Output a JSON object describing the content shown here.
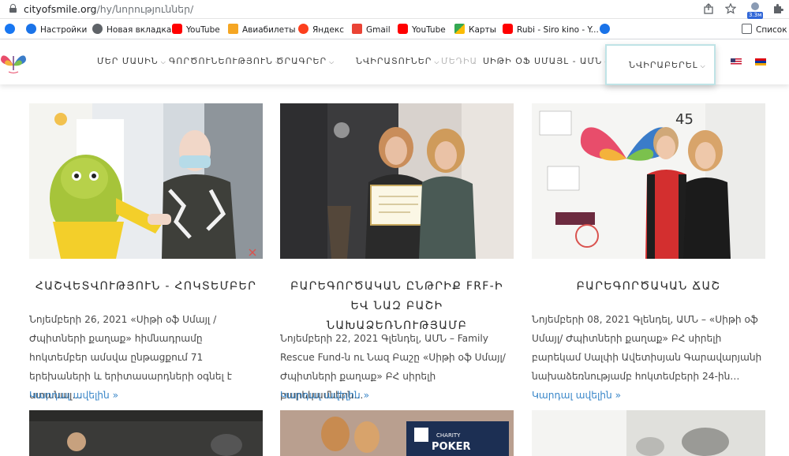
{
  "browser": {
    "url_host": "cityofsmile.org",
    "url_path": "/hy/նորություններ/",
    "profile_badge": "3.3м",
    "bookmarks": [
      {
        "label": "",
        "icon": "facebook-icon"
      },
      {
        "label": "Настройки",
        "icon": "settings-gear-icon"
      },
      {
        "label": "Новая вкладка",
        "icon": "globe-icon"
      },
      {
        "label": "YouTube",
        "icon": "youtube-icon"
      },
      {
        "label": "Авиабилеты",
        "icon": "aviasales-icon"
      },
      {
        "label": "Яндекс",
        "icon": "yandex-icon"
      },
      {
        "label": "Gmail",
        "icon": "gmail-icon"
      },
      {
        "label": "YouTube",
        "icon": "youtube-icon"
      },
      {
        "label": "Карты",
        "icon": "maps-icon"
      },
      {
        "label": "Rubi - Siro kino - Y...",
        "icon": "youtube-icon"
      },
      {
        "label": "",
        "icon": "edge-icon"
      },
      {
        "label": "Список д",
        "icon": "reading-list-icon"
      }
    ]
  },
  "nav": {
    "items": [
      {
        "label": "ՄԵՐ ՄԱՍԻՆ",
        "dropdown": true
      },
      {
        "label": "ԳՈՐԾՈՒՆԵՈՒԹՅՈՒՆ",
        "dropdown": true
      },
      {
        "label": "ԾՐԱԳՐԵՐ",
        "dropdown": true
      },
      {
        "label": "ՆՎԻՐԱՏՈՒՆԵՐ",
        "dropdown": true
      },
      {
        "label": "ՄԵԴԻԱ",
        "dropdown": false
      },
      {
        "label": "ՍԻԹԻ ՕՖ ՍՄԱՅԼ - ԱՄՆ",
        "dropdown": true
      }
    ],
    "donate_label": "ՆՎԻՐԱԲԵՐԵԼ"
  },
  "articles": [
    {
      "title": "ՀԱՇՎԵՏՎՈՒԹՅՈՒՆ - ՀՈԿՏԵՄԲԵՐ",
      "excerpt": "Նոյեմբերի 26, 2021 «Սիթի օֆ Սմայլ / Ժպիտների քաղաք» հիմնադրամը հոկտեմբեր ամսվա ընթացքում 71 երեխաների և երիտասարդների օգնել է ստանալ…",
      "read_more": "Կարդալ ավելին »"
    },
    {
      "title": "ԲԱՐԵԳՈՐԾԱԿԱՆ ԸՆԹՐԻՔ FRF-Ի ԵՎ ՆԱԶ ԲԱՇԻ ՆԱԽԱՁԵՌՆՈՒԹՅԱՄԲ",
      "excerpt": "Նոյեմբերի 22, 2021 Գլենդել, ԱՄՆ – Family Rescue Fund-ն ու Նազ Բաշը «Սիթի օֆ Սմայլ/ Ժպիտների քաղաք» ԲՀ սիրելի բարեկամներն…",
      "read_more": "Կարդալ ավելին »"
    },
    {
      "title": "ԲԱՐԵԳՈՐԾԱԿԱՆ ՃԱՇ",
      "excerpt": "Նոյեմբերի 08, 2021 Գլենդել, ԱՄՆ – «Սիթի օֆ Սմայլ/ Ժպիտների քաղաք» ԲՀ սիրելի բարեկամ Սալփի Ավետիսյան Գարավարյանի նախաձեռնությամբ հոկտեմբերի 24-ին…",
      "read_more": "Կարդալ ավելին »"
    }
  ],
  "colors": {
    "accent_link": "#3a87c9",
    "donate_border": "#bfe3e6",
    "nav_text": "#404040"
  }
}
